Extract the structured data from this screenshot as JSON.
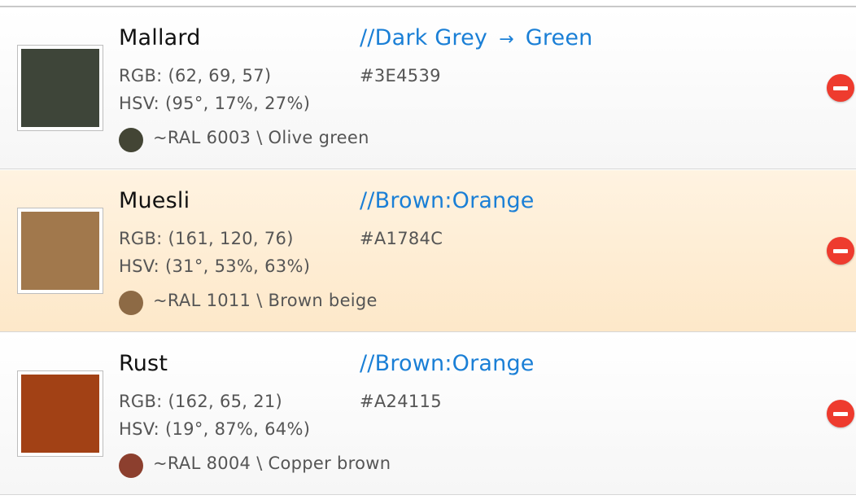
{
  "colors": [
    {
      "name": "Mallard",
      "category_start": "//Dark Grey",
      "category_arrow": "→",
      "category_end": "Green",
      "rgb": "RGB: (62, 69, 57)",
      "hsv": "HSV: (95°, 17%, 27%)",
      "hex": "#3E4539",
      "swatch_color": "#3E4539",
      "ral": "~RAL 6003 \\ Olive green",
      "ral_color": "#434535",
      "remove_icon": "minus-circle-icon"
    },
    {
      "name": "Muesli",
      "category_start": "//Brown:Orange",
      "category_arrow": "",
      "category_end": "",
      "rgb": "RGB: (161, 120, 76)",
      "hsv": "HSV: (31°, 53%, 63%)",
      "hex": "#A1784C",
      "swatch_color": "#A1784C",
      "ral": "~RAL 1011 \\ Brown beige",
      "ral_color": "#8D6A45",
      "remove_icon": "minus-circle-icon"
    },
    {
      "name": "Rust",
      "category_start": "//Brown:Orange",
      "category_arrow": "",
      "category_end": "",
      "rgb": "RGB: (162, 65, 21)",
      "hsv": "HSV: (19°, 87%, 64%)",
      "hex": "#A24115",
      "swatch_color": "#A24115",
      "ral": "~RAL 8004 \\ Copper brown",
      "ral_color": "#8C3F2E",
      "remove_icon": "minus-circle-icon"
    }
  ],
  "theme": {
    "category_color": "#1a7fd6",
    "remove_color": "#ee3b2e"
  }
}
